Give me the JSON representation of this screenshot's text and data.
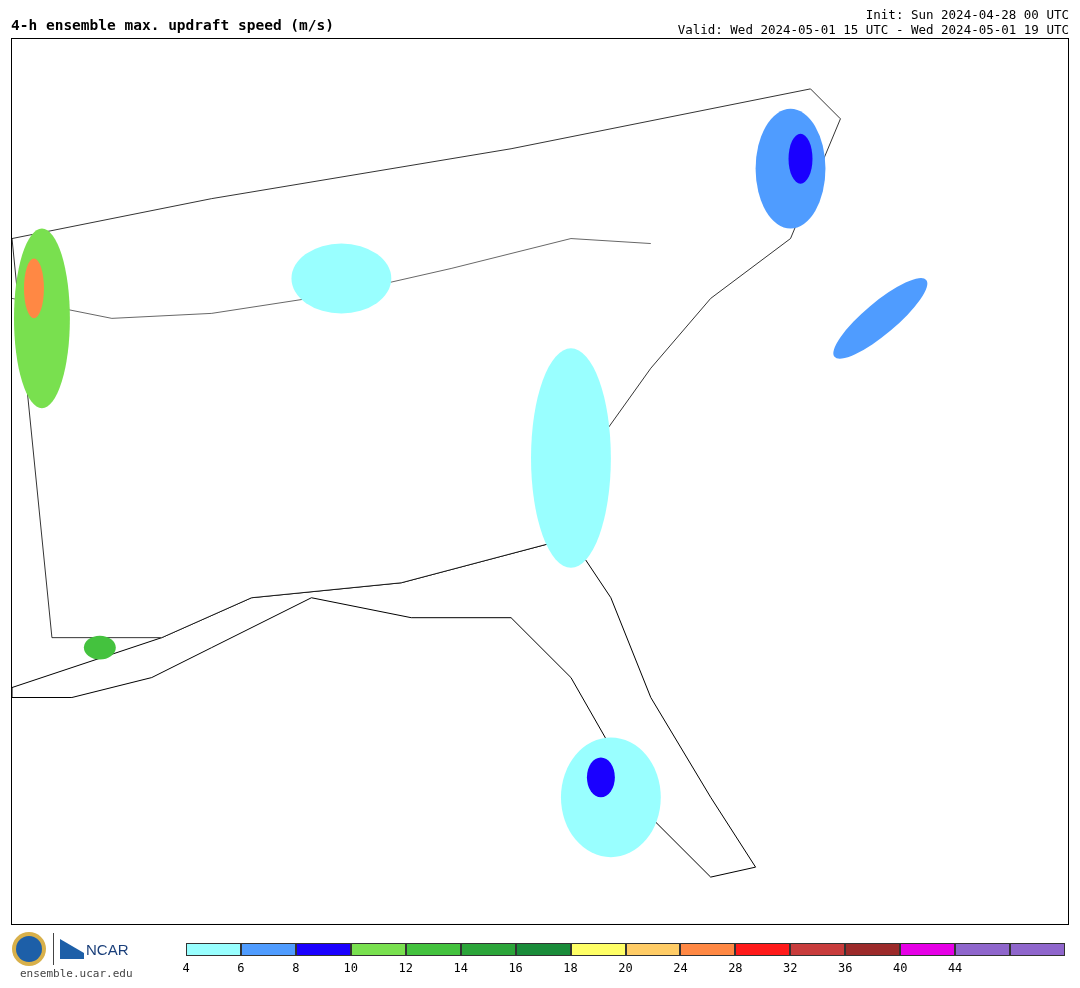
{
  "title": "4-h ensemble max. updraft speed (m/s)",
  "init": "Init: Sun 2024-04-28 00 UTC",
  "valid": "Valid: Wed 2024-05-01 15 UTC - Wed 2024-05-01 19 UTC",
  "footer": {
    "logo_text": "NCAR",
    "site": "ensemble.ucar.edu"
  },
  "legend": {
    "bins": [
      {
        "color": "#99ffff",
        "label": "4"
      },
      {
        "color": "#4f9cff",
        "label": "6"
      },
      {
        "color": "#1a00ff",
        "label": "8"
      },
      {
        "color": "#79e04f",
        "label": "10"
      },
      {
        "color": "#44c23e",
        "label": "12"
      },
      {
        "color": "#2ca53a",
        "label": "14"
      },
      {
        "color": "#1a8c3a",
        "label": "16"
      },
      {
        "color": "#ffff66",
        "label": "18"
      },
      {
        "color": "#ffcc66",
        "label": "20"
      },
      {
        "color": "#ff8844",
        "label": "24"
      },
      {
        "color": "#ff1a1a",
        "label": "28"
      },
      {
        "color": "#c83c3c",
        "label": "32"
      },
      {
        "color": "#9c2a2a",
        "label": "36"
      },
      {
        "color": "#e600e6",
        "label": "40"
      },
      {
        "color": "#8f66cc",
        "label": "44"
      },
      {
        "color": "#8f66cc"
      }
    ]
  }
}
